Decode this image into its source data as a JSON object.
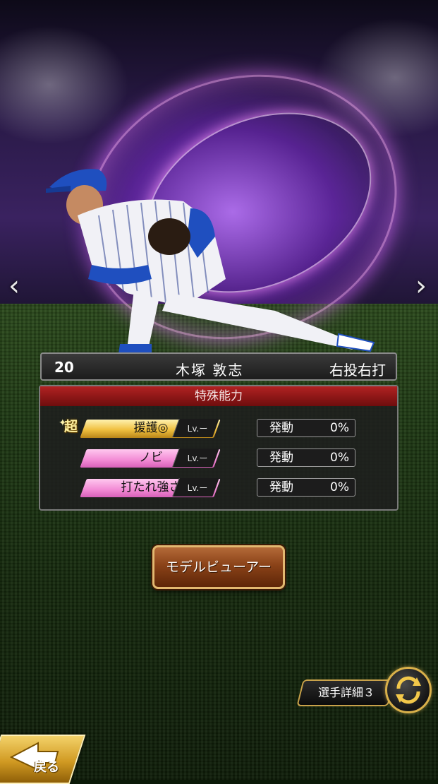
{
  "player": {
    "number": "20",
    "name": "木塚 敦志",
    "handedness": "右投右打"
  },
  "abilities": {
    "header": "特殊能力",
    "items": [
      {
        "super_label": "超",
        "name": "援護◎",
        "level": "Lv.ー",
        "trigger_label": "発動",
        "rate": "0%",
        "color": "#f0c040"
      },
      {
        "super_label": "",
        "name": "ノビ",
        "level": "Lv.ー",
        "trigger_label": "発動",
        "rate": "0%",
        "color": "#f28ad4"
      },
      {
        "super_label": "",
        "name": "打たれ強さ",
        "level": "Lv.ー",
        "trigger_label": "発動",
        "rate": "0%",
        "color": "#f28ad4"
      }
    ]
  },
  "buttons": {
    "model_viewer": "モデルビューアー",
    "player_detail": "選手詳細３",
    "back": "戻る"
  },
  "icons": {
    "prev": "chevron-left-icon",
    "next": "chevron-right-icon",
    "cycle": "cycle-arrows-icon",
    "back": "back-arrow-icon"
  }
}
